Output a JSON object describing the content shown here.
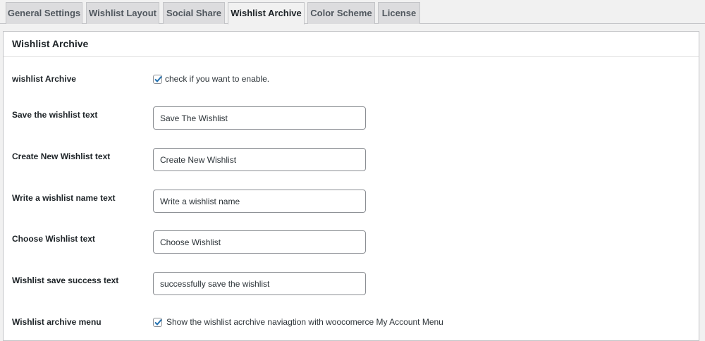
{
  "tabs": [
    {
      "label": "General Settings"
    },
    {
      "label": "Wishlist Layout"
    },
    {
      "label": "Social Share"
    },
    {
      "label": "Wishlist Archive"
    },
    {
      "label": "Color Scheme"
    },
    {
      "label": "License"
    }
  ],
  "active_tab": "Wishlist Archive",
  "panel": {
    "title": "Wishlist Archive",
    "archive_enable": {
      "label": "wishlist Archive",
      "checkbox_label": "check if you want to enable.",
      "checked": true
    },
    "save_text": {
      "label": "Save the wishlist text",
      "value": "Save The Wishlist"
    },
    "create_new_text": {
      "label": "Create New Wishlist text",
      "value": "Create New Wishlist"
    },
    "name_text": {
      "label": "Write a wishlist name text",
      "value": "Write a wishlist name"
    },
    "choose_text": {
      "label": "Choose Wishlist text",
      "value": "Choose Wishlist"
    },
    "success_text": {
      "label": "Wishlist save success text",
      "value": "successfully save the wishlist"
    },
    "archive_menu": {
      "label": "Wishlist archive menu",
      "checkbox_label": "Show the wishlist acrchive naviagtion with woocomerce My Account Menu",
      "checked": true
    }
  },
  "colors": {
    "accent": "#2271b1",
    "border": "#c3c4c7",
    "background": "#f1f1f1"
  }
}
